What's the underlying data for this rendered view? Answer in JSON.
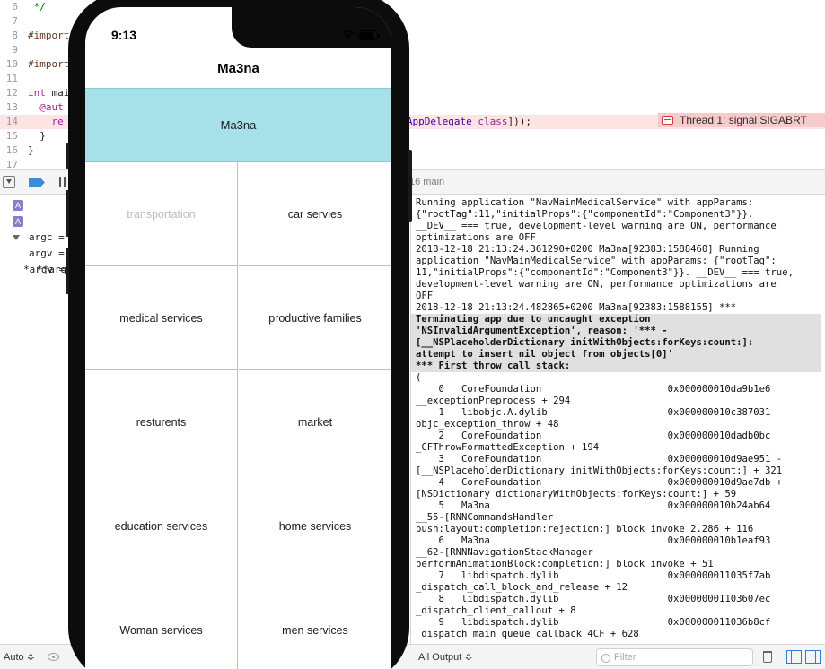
{
  "editor": {
    "lines": [
      {
        "num": "6",
        "segments": [
          {
            "t": " */",
            "c": "cm"
          }
        ]
      },
      {
        "num": "7",
        "segments": []
      },
      {
        "num": "8",
        "segments": [
          {
            "t": "#import",
            "c": "pp"
          }
        ]
      },
      {
        "num": "9",
        "segments": []
      },
      {
        "num": "10",
        "segments": [
          {
            "t": "#import",
            "c": "pp"
          }
        ]
      },
      {
        "num": "11",
        "segments": []
      },
      {
        "num": "12",
        "segments": [
          {
            "t": "int",
            "c": "kw"
          },
          {
            "t": " mai",
            "c": ""
          }
        ]
      },
      {
        "num": "13",
        "segments": [
          {
            "t": "  @aut",
            "c": "kw"
          }
        ]
      },
      {
        "num": "14",
        "segments": [
          {
            "t": "    re",
            "c": "kw"
          }
        ]
      },
      {
        "num": "15",
        "segments": [
          {
            "t": "  }",
            "c": ""
          }
        ]
      },
      {
        "num": "16",
        "segments": [
          {
            "t": "}",
            "c": ""
          }
        ]
      },
      {
        "num": "17",
        "segments": []
      }
    ],
    "line14_tail": [
      {
        "t": "s([",
        "c": ""
      },
      {
        "t": "AppDelegate",
        "c": "cls"
      },
      {
        "t": " ",
        "c": ""
      },
      {
        "t": "class",
        "c": "kw"
      },
      {
        "t": "]));",
        "c": ""
      }
    ],
    "error_badge": "Thread 1: signal SIGABRT"
  },
  "debug_bar": {
    "thread_label": "16 main"
  },
  "variables": [
    {
      "badge": "A",
      "text": "argc = "
    },
    {
      "badge": "A",
      "text": "argv = "
    },
    {
      "badge": "",
      "text": "*argv = "
    },
    {
      "badge": "",
      "text": "**arg"
    }
  ],
  "console": {
    "lines": [
      {
        "t": "Running application \"NavMainMedicalService\" with appParams:",
        "hl": false
      },
      {
        "t": "{\"rootTag\":11,\"initialProps\":{\"componentId\":\"Component3\"}}.",
        "hl": false
      },
      {
        "t": "__DEV__ === true, development-level warning are ON, performance",
        "hl": false
      },
      {
        "t": "optimizations are OFF",
        "hl": false
      },
      {
        "t": "2018-12-18 21:13:24.361290+0200 Ma3na[92383:1588460] Running",
        "hl": false
      },
      {
        "t": "application \"NavMainMedicalService\" with appParams: {\"rootTag\":",
        "hl": false
      },
      {
        "t": "11,\"initialProps\":{\"componentId\":\"Component3\"}}. __DEV__ === true,",
        "hl": false
      },
      {
        "t": "development-level warning are ON, performance optimizations are",
        "hl": false
      },
      {
        "t": "OFF",
        "hl": false
      },
      {
        "t": "2018-12-18 21:13:24.482865+0200 Ma3na[92383:1588155] ***",
        "hl": false
      },
      {
        "t": "Terminating app due to uncaught exception",
        "hl": true
      },
      {
        "t": "'NSInvalidArgumentException', reason: '*** -",
        "hl": true
      },
      {
        "t": "[__NSPlaceholderDictionary initWithObjects:forKeys:count:]:",
        "hl": true
      },
      {
        "t": "attempt to insert nil object from objects[0]'",
        "hl": true
      },
      {
        "t": "*** First throw call stack:",
        "hl": true
      },
      {
        "t": "(",
        "hl": false
      },
      {
        "t": "    0   CoreFoundation                      0x000000010da9b1e6",
        "hl": false
      },
      {
        "t": "__exceptionPreprocess + 294",
        "hl": false
      },
      {
        "t": "    1   libobjc.A.dylib                     0x000000010c387031",
        "hl": false
      },
      {
        "t": "objc_exception_throw + 48",
        "hl": false
      },
      {
        "t": "    2   CoreFoundation                      0x000000010dadb0bc",
        "hl": false
      },
      {
        "t": "_CFThrowFormattedException + 194",
        "hl": false
      },
      {
        "t": "    3   CoreFoundation                      0x000000010d9ae951 -",
        "hl": false
      },
      {
        "t": "[__NSPlaceholderDictionary initWithObjects:forKeys:count:] + 321",
        "hl": false
      },
      {
        "t": "    4   CoreFoundation                      0x000000010d9ae7db +",
        "hl": false
      },
      {
        "t": "[NSDictionary dictionaryWithObjects:forKeys:count:] + 59",
        "hl": false
      },
      {
        "t": "    5   Ma3na                               0x000000010b24ab64",
        "hl": false
      },
      {
        "t": "__55-[RNNCommandsHandler",
        "hl": false
      },
      {
        "t": "push:layout:completion:rejection:]_block_invoke_2.286 + 116",
        "hl": false
      },
      {
        "t": "    6   Ma3na                               0x000000010b1eaf93",
        "hl": false
      },
      {
        "t": "__62-[RNNNavigationStackManager",
        "hl": false
      },
      {
        "t": "performAnimationBlock:completion:]_block_invoke + 51",
        "hl": false
      },
      {
        "t": "    7   libdispatch.dylib                   0x000000011035f7ab",
        "hl": false
      },
      {
        "t": "_dispatch_call_block_and_release + 12",
        "hl": false
      },
      {
        "t": "    8   libdispatch.dylib                   0x00000001103607ec",
        "hl": false
      },
      {
        "t": "_dispatch_client_callout + 8",
        "hl": false
      },
      {
        "t": "    9   libdispatch.dylib                   0x000000011036b8cf",
        "hl": false
      },
      {
        "t": "_dispatch_main_queue_callback_4CF + 628",
        "hl": false
      }
    ]
  },
  "bottom_bar": {
    "auto_label": "Auto ≎",
    "output_label": "All Output ≎",
    "filter_placeholder": "Filter"
  },
  "phone": {
    "time": "9:13",
    "nav_title": "Ma3na",
    "banner_label": "Ma3na",
    "cells": [
      {
        "label": "transportation",
        "disabled": true
      },
      {
        "label": "car servies",
        "disabled": false
      },
      {
        "label": "medical services",
        "disabled": false
      },
      {
        "label": "productive families",
        "disabled": false
      },
      {
        "label": "resturents",
        "disabled": false
      },
      {
        "label": "market",
        "disabled": false
      },
      {
        "label": "education services",
        "disabled": false
      },
      {
        "label": "home services",
        "disabled": false
      },
      {
        "label": "Woman services",
        "disabled": false
      },
      {
        "label": "men services",
        "disabled": false
      }
    ]
  }
}
